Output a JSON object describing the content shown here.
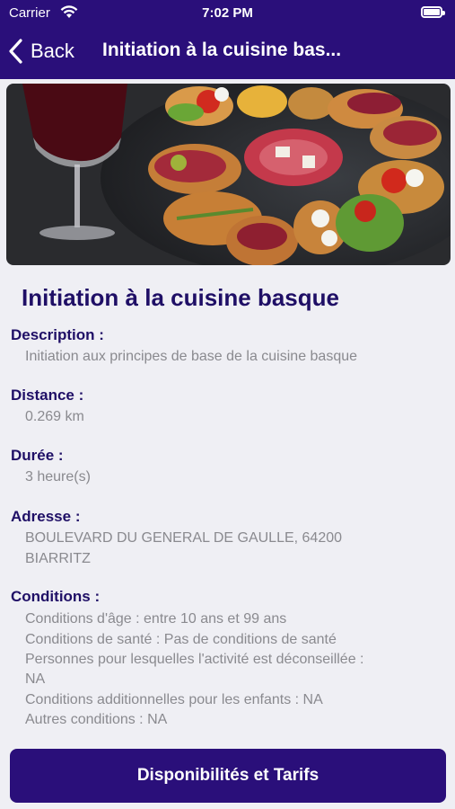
{
  "status_bar": {
    "carrier": "Carrier",
    "time": "7:02 PM"
  },
  "nav": {
    "back_label": "Back",
    "title": "Initiation à la cuisine bas..."
  },
  "activity": {
    "title": "Initiation à la cuisine basque",
    "description_label": "Description :",
    "description_value": "Initiation aux principes de base de la cuisine basque",
    "distance_label": "Distance :",
    "distance_value": "0.269 km",
    "duration_label": "Durée :",
    "duration_value": "3 heure(s)",
    "address_label": "Adresse :",
    "address_line1": "BOULEVARD DU GENERAL DE GAULLE, 64200",
    "address_line2": "BIARRITZ",
    "conditions_label": "Conditions :",
    "conditions": [
      "Conditions d'âge : entre 10 ans et 99 ans",
      "Conditions de santé : Pas de conditions de santé",
      "Personnes pour lesquelles l'activité est déconseillée :",
      "NA",
      "Conditions additionnelles pour les enfants : NA",
      "Autres conditions : NA"
    ]
  },
  "cta": {
    "label": "Disponibilités et Tarifs"
  },
  "colors": {
    "brand": "#2a0f7a",
    "heading": "#1f0f66",
    "muted": "#8a8a8f",
    "background": "#efeff4"
  }
}
